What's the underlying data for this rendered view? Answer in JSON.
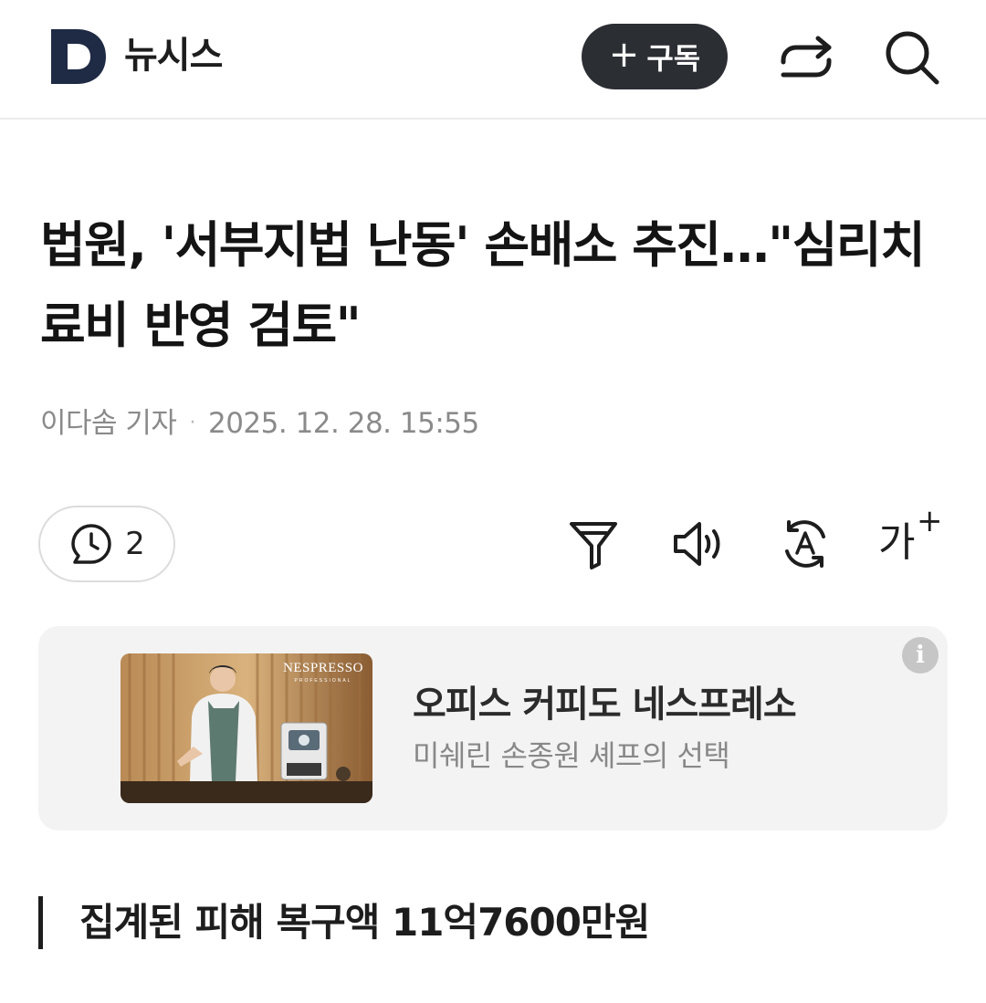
{
  "header": {
    "brand": "뉴시스",
    "subscribe_label": "구독",
    "subscribe_plus": "+",
    "logo_letter": "D",
    "logo_color": "#1f2a44"
  },
  "article": {
    "title": "법원, '서부지법 난동' 손배소 추진…\"심리치료비 반영 검토\"",
    "author": "이다솜 기자",
    "separator": "·",
    "datetime": "2025. 12. 28. 15:55",
    "subheading": "집계된 피해 복구액 11억7600만원"
  },
  "toolbar": {
    "comment_count": "2",
    "font_size_label": "가",
    "font_size_plus": "+",
    "icons": [
      "comment-icon",
      "filter-icon",
      "speaker-icon",
      "translate-icon",
      "font-size-icon"
    ]
  },
  "ad": {
    "brand_on_image": "NESPRESSO",
    "brand_sub_on_image": "PROFESSIONAL",
    "title": "오피스 커피도 네스프레소",
    "subtitle": "미쉐린 손종원 셰프의 선택",
    "info_glyph": "i"
  },
  "colors": {
    "accent_dark": "#2b2e33",
    "meta_gray": "#8a8a8a",
    "ad_bg": "#f3f3f3"
  }
}
